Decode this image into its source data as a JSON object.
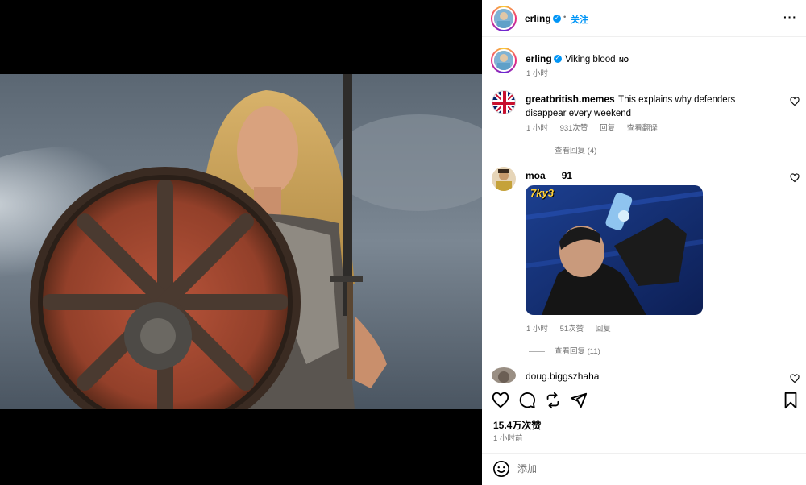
{
  "post": {
    "author": "erling",
    "follow_label": "关注",
    "dot": "•",
    "more_icon": "more-horizontal-icon",
    "caption": "Viking blood",
    "caption_flag": "NO",
    "caption_time": "1 小时",
    "likes": "15.4万次赞",
    "posted_time": "1 小时前",
    "add_comment_placeholder": "添加"
  },
  "comments": [
    {
      "user": "greatbritish.memes",
      "text": "This explains why defenders disappear every weekend",
      "time": "1 小时",
      "likes": "931次赞",
      "reply": "回复",
      "translate": "查看翻译",
      "view_replies": "查看回复 (4)"
    },
    {
      "user": "moa___91",
      "gif_text": "7ky3",
      "time": "1 小时",
      "likes": "51次赞",
      "reply": "回复",
      "view_replies": "查看回复 (11)"
    },
    {
      "user": "doug.biggszhaha"
    }
  ],
  "colors": {
    "verified": "#0095f6",
    "meta": "#737373",
    "border": "#efefef"
  }
}
